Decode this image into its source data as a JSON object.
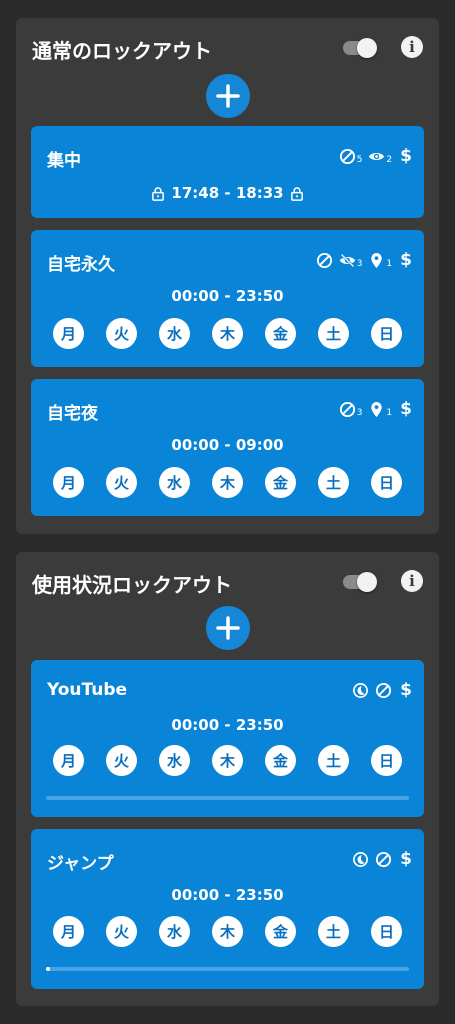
{
  "sections": [
    {
      "title": "通常のロックアウト",
      "enabled": true,
      "cards": [
        {
          "title": "集中",
          "icons": {
            "block_count": "5",
            "view_count": "2"
          },
          "time": "17:48 - 18:33"
        },
        {
          "title": "自宅永久",
          "icons": {
            "hidden_count": "3",
            "location_count": "1"
          },
          "time": "00:00 - 23:50",
          "days": [
            "月",
            "火",
            "水",
            "木",
            "金",
            "土",
            "日"
          ]
        },
        {
          "title": "自宅夜",
          "icons": {
            "block_count": "3",
            "location_count": "1"
          },
          "time": "00:00 - 09:00",
          "days": [
            "月",
            "火",
            "水",
            "木",
            "金",
            "土",
            "日"
          ]
        }
      ]
    },
    {
      "title": "使用状況ロックアウト",
      "enabled": true,
      "cards": [
        {
          "title": "YouTube",
          "time": "00:00 - 23:50",
          "days": [
            "月",
            "火",
            "水",
            "木",
            "金",
            "土",
            "日"
          ],
          "progress": 0.0
        },
        {
          "title": "ジャンプ",
          "time": "00:00 - 23:50",
          "days": [
            "月",
            "火",
            "水",
            "木",
            "金",
            "土",
            "日"
          ],
          "progress": 0.01
        }
      ]
    }
  ],
  "icons": {
    "dollar": "$",
    "info": "i"
  },
  "colors": {
    "card": "#0a84d6",
    "section": "#3b3b3b",
    "background": "#2b2b2b",
    "add_button": "#1587d6"
  }
}
